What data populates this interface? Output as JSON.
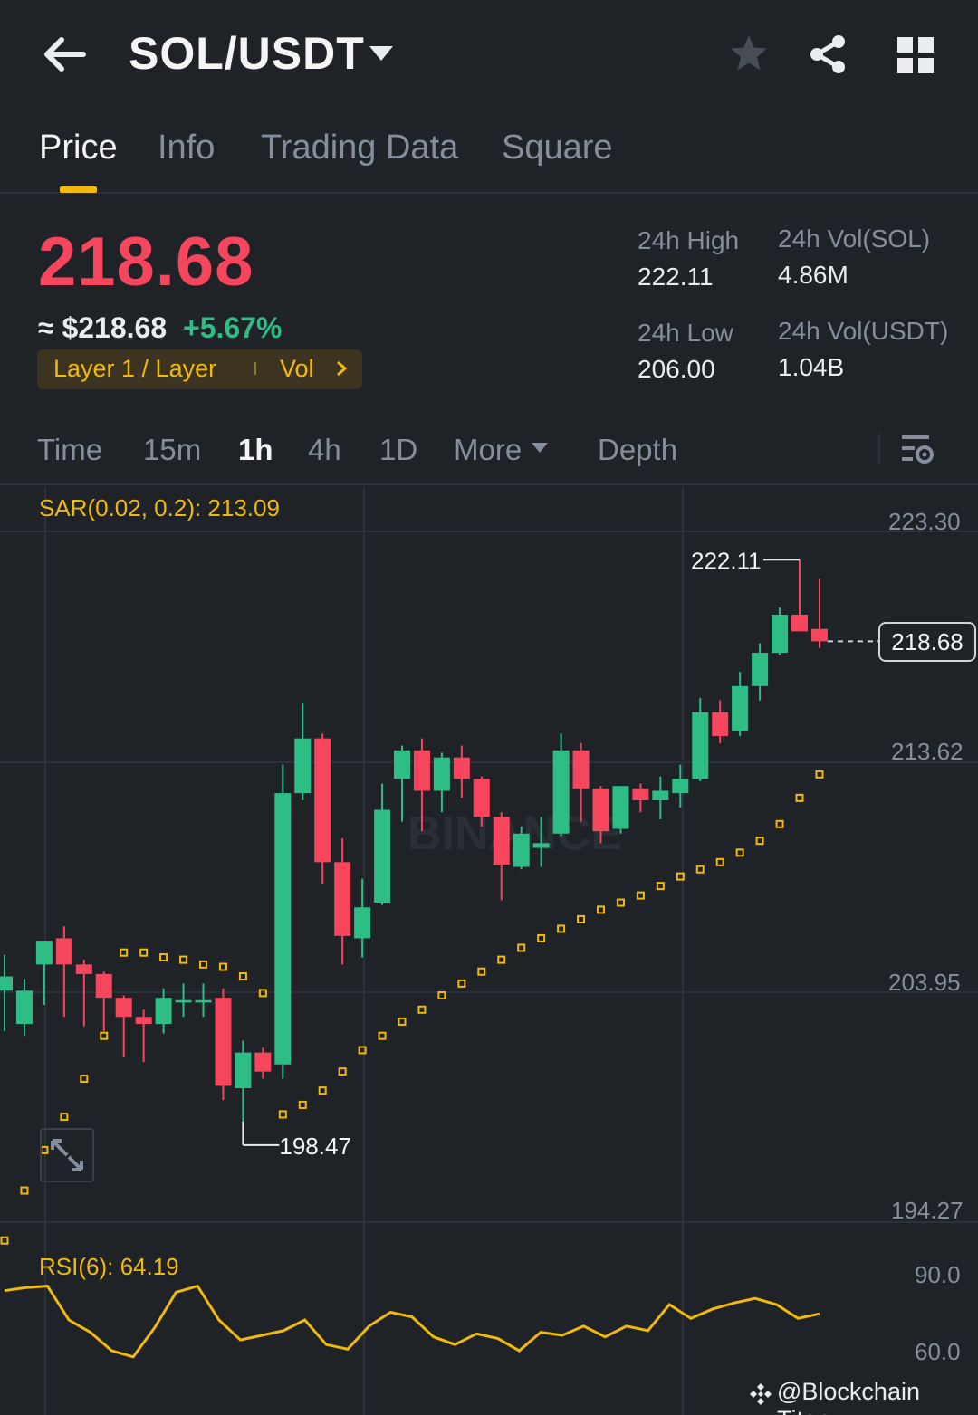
{
  "header": {
    "pair": "SOL/USDT",
    "icons": [
      "back-arrow-icon",
      "caret-down-icon",
      "star-icon",
      "share-icon",
      "grid-icon"
    ]
  },
  "tabs": [
    {
      "label": "Price",
      "active": true
    },
    {
      "label": "Info"
    },
    {
      "label": "Trading Data"
    },
    {
      "label": "Square"
    }
  ],
  "price": {
    "last": "218.68",
    "approx": "≈ $218.68",
    "change": "+5.67%",
    "tag": "Layer 1 / Layer",
    "vol_link": "Vol",
    "colors": {
      "down": "#f6465d",
      "up": "#2ebd85",
      "accent": "#f0b90b"
    }
  },
  "stats": {
    "high_label": "24h High",
    "high": "222.11",
    "low_label": "24h Low",
    "low": "206.00",
    "vol_sol_label": "24h Vol(SOL)",
    "vol_sol": "4.86M",
    "vol_usdt_label": "24h Vol(USDT)",
    "vol_usdt": "1.04B"
  },
  "timeframes": {
    "items": [
      "Time",
      "15m",
      "1h",
      "4h",
      "1D"
    ],
    "active": "1h",
    "more": "More",
    "depth": "Depth"
  },
  "chart": {
    "sar_label": "SAR(0.02, 0.2): 213.09",
    "rsi_label": "RSI(6): 64.19",
    "axis": [
      "223.30",
      "213.62",
      "203.95",
      "194.27"
    ],
    "rsi_axis": [
      "90.0",
      "60.0"
    ],
    "high_marker": "222.11",
    "low_marker": "198.47",
    "last_tag": "218.68",
    "watermark": "BINANCE"
  },
  "chart_data": {
    "type": "candlestick",
    "interval": "1h",
    "ylim": [
      194.27,
      223.3
    ],
    "candles": [
      {
        "o": 204.0,
        "h": 205.5,
        "l": 202.3,
        "c": 204.6
      },
      {
        "o": 202.6,
        "h": 204.5,
        "l": 202.1,
        "c": 204.0
      },
      {
        "o": 205.1,
        "h": 205.9,
        "l": 203.4,
        "c": 206.1
      },
      {
        "o": 206.2,
        "h": 206.7,
        "l": 202.9,
        "c": 205.1
      },
      {
        "o": 205.1,
        "h": 205.3,
        "l": 202.5,
        "c": 204.7
      },
      {
        "o": 204.7,
        "h": 204.8,
        "l": 202.3,
        "c": 203.7
      },
      {
        "o": 203.7,
        "h": 203.8,
        "l": 201.2,
        "c": 202.9
      },
      {
        "o": 202.9,
        "h": 203.2,
        "l": 201.0,
        "c": 202.6
      },
      {
        "o": 202.6,
        "h": 204.1,
        "l": 202.2,
        "c": 203.7
      },
      {
        "o": 203.5,
        "h": 204.3,
        "l": 202.9,
        "c": 203.6
      },
      {
        "o": 203.5,
        "h": 204.3,
        "l": 202.9,
        "c": 203.6
      },
      {
        "o": 203.7,
        "h": 204.1,
        "l": 199.4,
        "c": 200.0
      },
      {
        "o": 199.9,
        "h": 201.9,
        "l": 198.5,
        "c": 201.4
      },
      {
        "o": 201.4,
        "h": 201.6,
        "l": 200.3,
        "c": 200.6
      },
      {
        "o": 200.9,
        "h": 213.5,
        "l": 200.3,
        "c": 212.3
      },
      {
        "o": 212.3,
        "h": 216.1,
        "l": 212.0,
        "c": 214.6
      },
      {
        "o": 214.6,
        "h": 214.8,
        "l": 208.5,
        "c": 209.4
      },
      {
        "o": 209.4,
        "h": 210.4,
        "l": 205.1,
        "c": 206.3
      },
      {
        "o": 206.2,
        "h": 208.7,
        "l": 205.4,
        "c": 207.5
      },
      {
        "o": 207.7,
        "h": 212.7,
        "l": 207.6,
        "c": 211.6
      },
      {
        "o": 212.9,
        "h": 214.3,
        "l": 211.1,
        "c": 214.1
      },
      {
        "o": 214.1,
        "h": 214.6,
        "l": 210.7,
        "c": 212.4
      },
      {
        "o": 212.4,
        "h": 214.0,
        "l": 211.5,
        "c": 213.8
      },
      {
        "o": 213.8,
        "h": 214.3,
        "l": 212.1,
        "c": 212.9
      },
      {
        "o": 212.9,
        "h": 213.0,
        "l": 210.9,
        "c": 211.3
      },
      {
        "o": 211.3,
        "h": 211.5,
        "l": 207.8,
        "c": 209.3
      },
      {
        "o": 209.2,
        "h": 210.9,
        "l": 209.1,
        "c": 210.6
      },
      {
        "o": 210.0,
        "h": 211.3,
        "l": 209.2,
        "c": 210.2
      },
      {
        "o": 210.6,
        "h": 214.8,
        "l": 210.5,
        "c": 214.1
      },
      {
        "o": 214.1,
        "h": 214.4,
        "l": 211.1,
        "c": 212.5
      },
      {
        "o": 212.5,
        "h": 212.6,
        "l": 210.2,
        "c": 210.7
      },
      {
        "o": 210.8,
        "h": 212.6,
        "l": 210.6,
        "c": 212.6
      },
      {
        "o": 212.5,
        "h": 212.7,
        "l": 211.5,
        "c": 212.0
      },
      {
        "o": 212.0,
        "h": 213.0,
        "l": 211.2,
        "c": 212.4
      },
      {
        "o": 212.3,
        "h": 213.5,
        "l": 211.7,
        "c": 212.9
      },
      {
        "o": 212.9,
        "h": 216.3,
        "l": 212.8,
        "c": 215.7
      },
      {
        "o": 215.7,
        "h": 216.2,
        "l": 214.4,
        "c": 214.7
      },
      {
        "o": 214.9,
        "h": 217.4,
        "l": 214.7,
        "c": 216.8
      },
      {
        "o": 216.8,
        "h": 218.6,
        "l": 216.2,
        "c": 218.2
      },
      {
        "o": 218.2,
        "h": 220.1,
        "l": 218.1,
        "c": 219.8
      },
      {
        "o": 219.8,
        "h": 222.11,
        "l": 219.4,
        "c": 219.1
      },
      {
        "o": 219.2,
        "h": 221.3,
        "l": 218.4,
        "c": 218.68
      }
    ],
    "sar": [
      193.5,
      195.6,
      197.3,
      198.7,
      200.3,
      202.1,
      205.6,
      205.6,
      205.4,
      205.3,
      205.1,
      205.0,
      204.6,
      203.9,
      198.8,
      199.2,
      199.8,
      200.6,
      201.5,
      202.1,
      202.7,
      203.2,
      203.8,
      204.3,
      204.8,
      205.3,
      205.8,
      206.2,
      206.6,
      207.0,
      207.4,
      207.7,
      208.0,
      208.4,
      208.8,
      209.1,
      209.4,
      209.8,
      210.3,
      211.0,
      212.1,
      213.09
    ],
    "rsi": [
      79,
      81,
      82,
      60,
      52,
      40,
      36,
      55,
      78,
      82,
      60,
      47,
      50,
      53,
      60,
      44,
      41,
      56,
      65,
      62,
      49,
      44,
      51,
      48,
      40,
      52,
      50,
      56,
      49,
      56,
      53,
      70,
      61,
      67,
      71,
      74,
      70,
      61,
      64
    ],
    "rsi_ylim": [
      40,
      90
    ]
  }
}
